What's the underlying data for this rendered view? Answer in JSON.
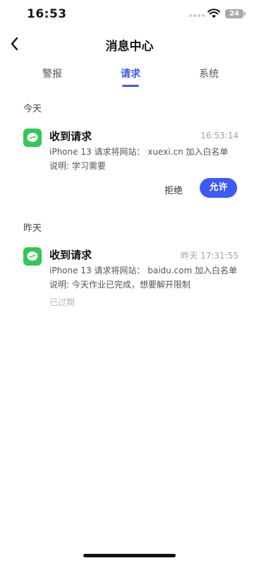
{
  "status_bar": {
    "time": "16:53",
    "battery": "24"
  },
  "nav": {
    "title": "消息中心"
  },
  "tabs": [
    {
      "label": "警报",
      "active": false
    },
    {
      "label": "请求",
      "active": true
    },
    {
      "label": "系统",
      "active": false
    }
  ],
  "sections": {
    "today": {
      "label": "今天",
      "card": {
        "title": "收到请求",
        "time": "16:53:14",
        "line1": "iPhone 13 请求将网站：  xuexi.cn 加入白名单",
        "line2": "说明: 学习需要",
        "reject_label": "拒绝",
        "allow_label": "允许"
      }
    },
    "yesterday": {
      "label": "昨天",
      "card": {
        "title": "收到请求",
        "time": "昨天 17:31:55",
        "line1": "iPhone 13 请求将网站：  baidu.com 加入白名单",
        "line2": "说明: 今天作业已完成，想要解开限制",
        "status": "已过期"
      }
    }
  },
  "colors": {
    "accent": "#3d5af1",
    "app_icon": "#34c759"
  },
  "icons": {
    "back": "chevron-left-icon",
    "app": "chat-bubble-icon"
  }
}
